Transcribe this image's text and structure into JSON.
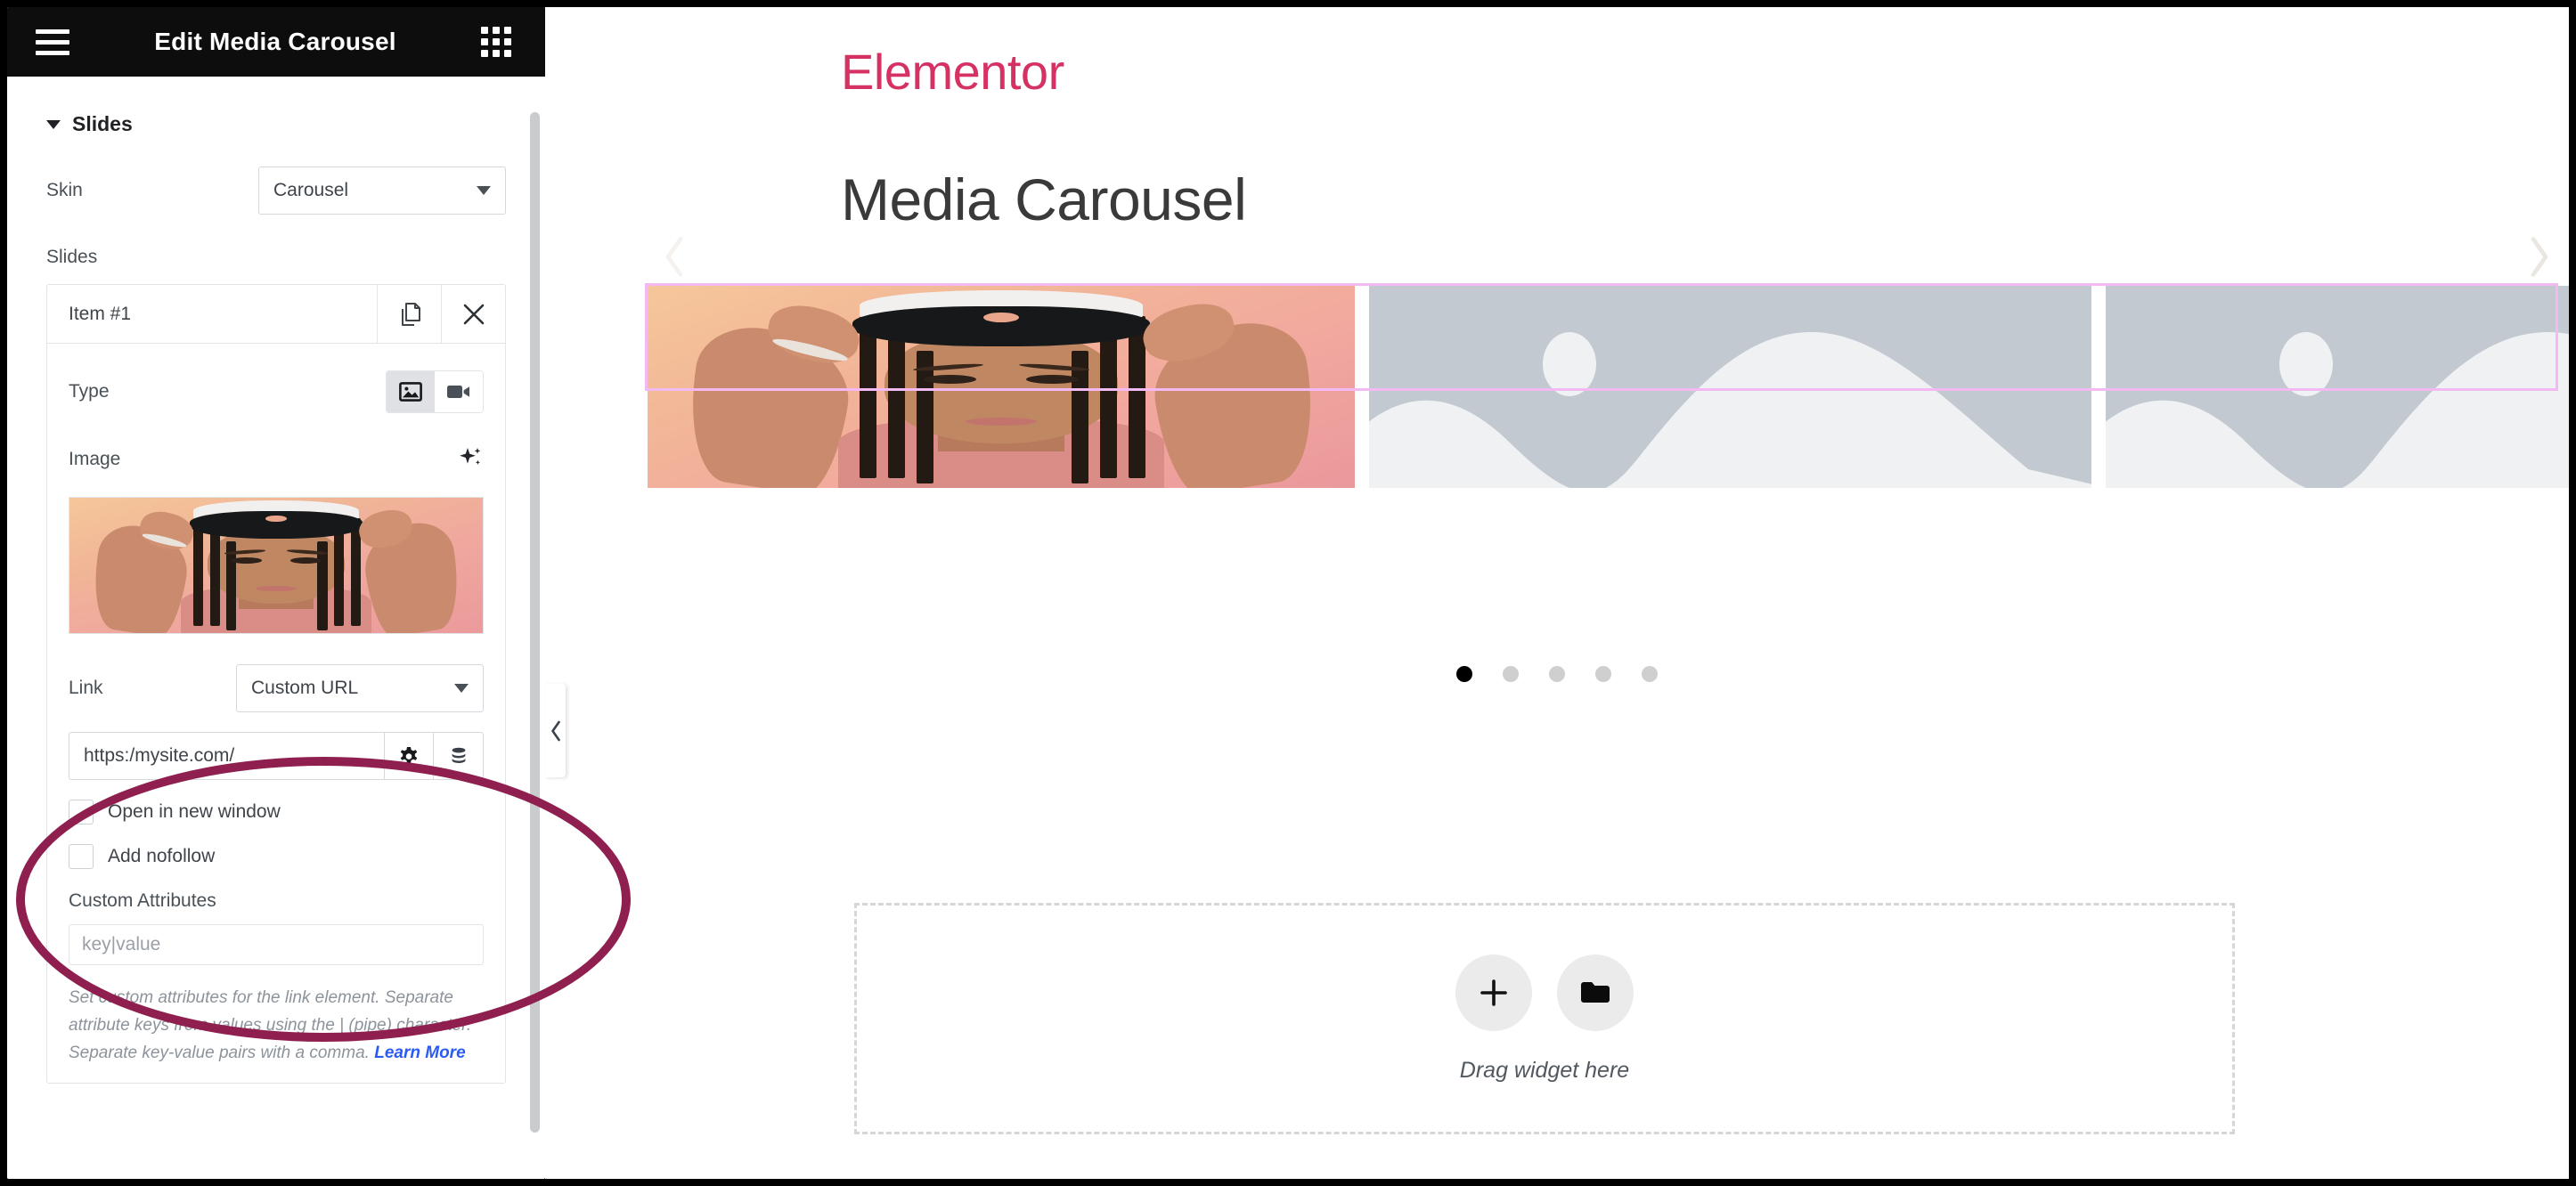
{
  "panel": {
    "header": {
      "title": "Edit Media Carousel",
      "menu_icon": "hamburger-icon",
      "widgets_icon": "grid-icon"
    },
    "section": {
      "title": "Slides",
      "collapse_icon": "caret-down-icon"
    },
    "skin": {
      "label": "Skin",
      "value": "Carousel",
      "dropdown_icon": "chevron-down-icon"
    },
    "slides_label": "Slides",
    "repeater": {
      "item_title": "Item #1",
      "duplicate_icon": "copy-icon",
      "remove_icon": "close-icon"
    },
    "type": {
      "label": "Type",
      "options": [
        "image",
        "video"
      ],
      "selected": "image",
      "image_icon": "image-icon",
      "video_icon": "video-camera-icon"
    },
    "image": {
      "label": "Image",
      "ai_icon": "sparkle-ai-icon"
    },
    "link": {
      "label": "Link",
      "value": "Custom URL",
      "dropdown_icon": "chevron-down-icon",
      "url_value": "https:/mysite.com/",
      "settings_icon": "gear-icon",
      "dynamic_icon": "database-icon",
      "open_new_window": {
        "label": "Open in new window",
        "checked": false
      },
      "add_nofollow": {
        "label": "Add nofollow",
        "checked": false
      }
    },
    "custom_attributes": {
      "label": "Custom Attributes",
      "placeholder": "key|value",
      "description": "Set custom attributes for the link element. Separate attribute keys from values using the | (pipe) character. Separate key-value pairs with a comma. ",
      "learn_more": "Learn More"
    },
    "collapse_handle_icon": "chevron-left-icon"
  },
  "canvas": {
    "brand": "Elementor",
    "page_title": "Media Carousel",
    "carousel": {
      "prev_icon": "chevron-left-icon",
      "next_icon": "chevron-right-icon",
      "slide_count": 5,
      "active_index": 0,
      "slides": [
        {
          "type": "image",
          "alt": "woman with braids adjusting a cap, sunset gradient background"
        },
        {
          "type": "placeholder",
          "alt": "image placeholder landscape"
        },
        {
          "type": "placeholder",
          "alt": "image placeholder landscape"
        }
      ]
    },
    "dropzone": {
      "add_icon": "plus-icon",
      "folder_icon": "folder-icon",
      "text": "Drag widget here"
    }
  },
  "colors": {
    "brand_pink": "#d63163",
    "panel_header_bg": "#0d0d0e",
    "section_outline": "#f3b9f3",
    "annotation": "#8e1f4f",
    "link_blue": "#2a5cf5",
    "placeholder_sky": "#c3c9d1",
    "placeholder_hill": "#f0f1f3"
  }
}
